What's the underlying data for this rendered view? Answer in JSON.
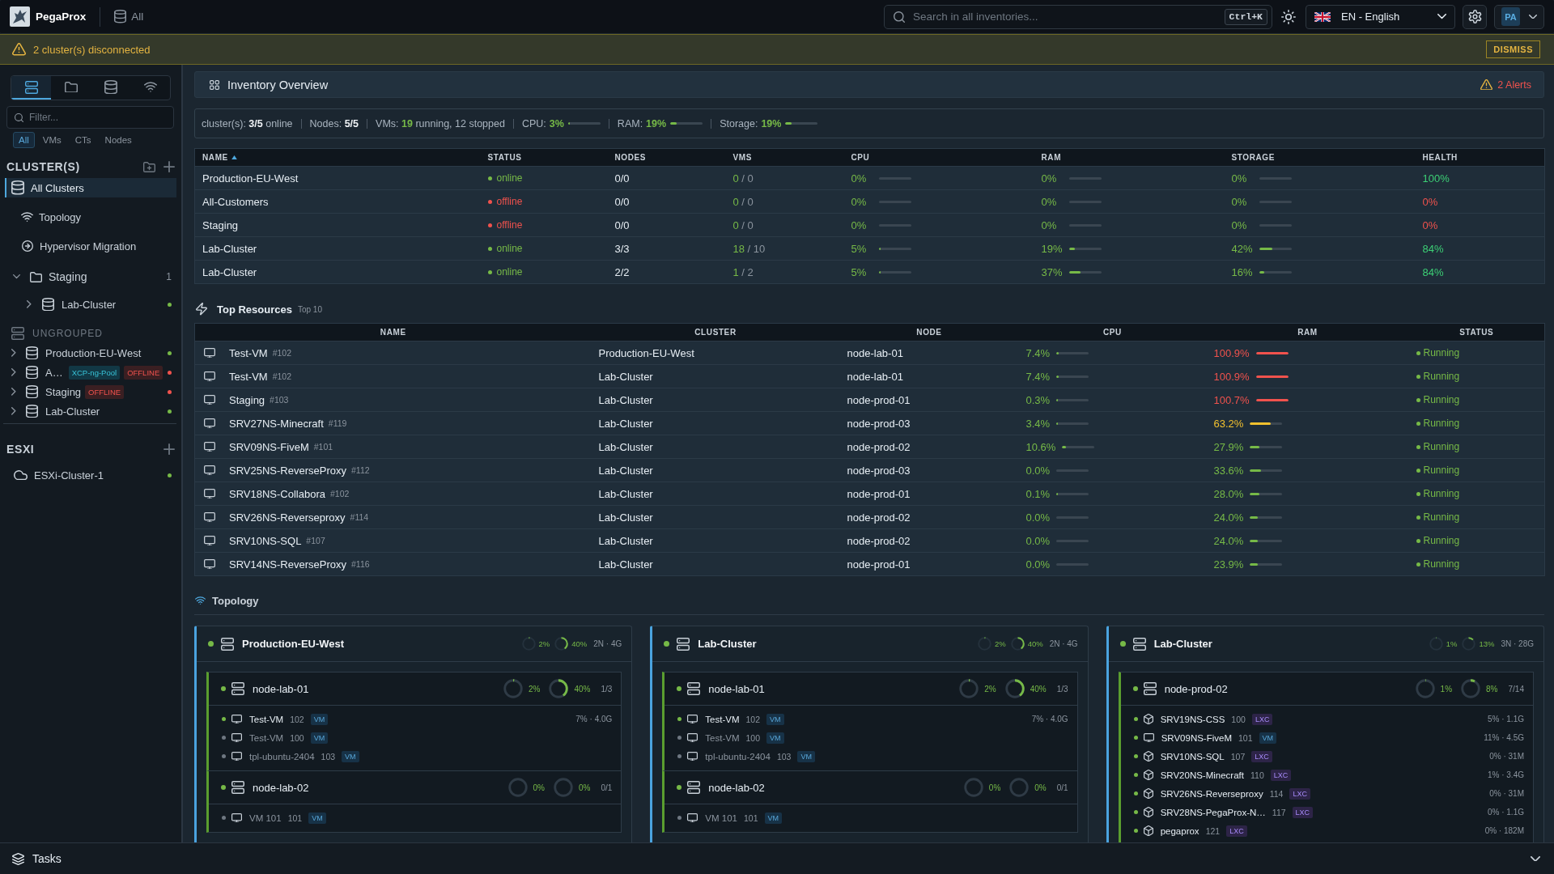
{
  "topbar": {
    "brand": "PegaProx",
    "scope": "All",
    "search": {
      "placeholder": "Search in all inventories...",
      "shortcut": "Ctrl+K"
    },
    "language": "EN - English",
    "user": {
      "initials": "PA"
    }
  },
  "alert_banner": {
    "message": "2 cluster(s) disconnected",
    "action": "DISMISS"
  },
  "sidebar": {
    "view_tabs": [
      {
        "kind": "servers",
        "selected": true
      },
      {
        "kind": "folders",
        "selected": false
      },
      {
        "kind": "storage",
        "selected": false
      },
      {
        "kind": "network",
        "selected": false
      }
    ],
    "filter": {
      "placeholder": "Filter..."
    },
    "filter_chips": [
      {
        "label": "All",
        "selected": true
      },
      {
        "label": "VMs",
        "selected": false
      },
      {
        "label": "CTs",
        "selected": false
      },
      {
        "label": "Nodes",
        "selected": false
      }
    ],
    "clusters": {
      "title": "CLUSTER(S)",
      "nav": [
        {
          "kind": "all",
          "label": "All Clusters",
          "selected": true
        },
        {
          "kind": "topology",
          "label": "Topology",
          "selected": false
        },
        {
          "kind": "migration",
          "label": "Hypervisor Migration",
          "selected": false
        }
      ],
      "groups": [
        {
          "label": "Staging",
          "count": "1",
          "expanded": true,
          "selected": false,
          "children": [
            {
              "label": "Lab-Cluster",
              "expanded": false,
              "online": true,
              "selected": false
            }
          ]
        }
      ],
      "ungrouped": {
        "title": "UNGROUPED",
        "items": [
          {
            "label": "Production-EU-West",
            "expanded": false,
            "online": true,
            "selected": false
          },
          {
            "label": "A…",
            "tag": "XCP-ng-Pool",
            "badge": "OFFLINE",
            "expanded": false,
            "online": false,
            "selected": false
          },
          {
            "label": "Staging",
            "badge": "OFFLINE",
            "expanded": false,
            "online": false,
            "selected": false
          },
          {
            "label": "Lab-Cluster",
            "expanded": false,
            "online": true,
            "selected": false
          }
        ]
      }
    },
    "esxi": {
      "title": "ESXI",
      "items": [
        {
          "label": "ESXi-Cluster-1",
          "online": true,
          "selected": false
        }
      ]
    }
  },
  "overview": {
    "title": "Inventory Overview",
    "alerts": "2 Alerts",
    "stats": [
      {
        "kind": "text",
        "text": "cluster(s): **3/5** online"
      },
      {
        "kind": "text",
        "text": "Nodes: **5/5**"
      },
      {
        "kind": "highlight",
        "text": "VMs: **19** running, 12 stopped"
      },
      {
        "kind": "meter",
        "label": "CPU:",
        "value": "3%",
        "level": 0.03
      },
      {
        "kind": "meter",
        "label": "RAM:",
        "value": "19%",
        "level": 0.19
      },
      {
        "kind": "meter",
        "label": "Storage:",
        "value": "19%",
        "level": 0.19
      }
    ]
  },
  "clusters_table": {
    "columns": [
      {
        "label": "NAME",
        "sorted": true
      },
      {
        "label": "STATUS",
        "sorted": false
      },
      {
        "label": "NODES",
        "sorted": false
      },
      {
        "label": "VMS",
        "sorted": false
      },
      {
        "label": "CPU",
        "sorted": false
      },
      {
        "label": "RAM",
        "sorted": false
      },
      {
        "label": "STORAGE",
        "sorted": false
      },
      {
        "label": "HEALTH",
        "sorted": false
      }
    ],
    "rows": [
      {
        "name": "Production-EU-West",
        "status": {
          "label": "online",
          "online": true
        },
        "nodes": "0/0",
        "vms": {
          "running": "0",
          "rest": "/ 0"
        },
        "cpu": {
          "value": "0%",
          "level": 0
        },
        "ram": {
          "value": "0%",
          "level": 0
        },
        "storage": {
          "value": "0%",
          "level": 0
        },
        "health": {
          "value": "100%",
          "healthy": true
        }
      },
      {
        "name": "All-Customers",
        "status": {
          "label": "offline",
          "online": false
        },
        "nodes": "0/0",
        "vms": {
          "running": "0",
          "rest": "/ 0"
        },
        "cpu": {
          "value": "0%",
          "level": 0
        },
        "ram": {
          "value": "0%",
          "level": 0
        },
        "storage": {
          "value": "0%",
          "level": 0
        },
        "health": {
          "value": "0%",
          "healthy": false
        }
      },
      {
        "name": "Staging",
        "status": {
          "label": "offline",
          "online": false
        },
        "nodes": "0/0",
        "vms": {
          "running": "0",
          "rest": "/ 0"
        },
        "cpu": {
          "value": "0%",
          "level": 0
        },
        "ram": {
          "value": "0%",
          "level": 0
        },
        "storage": {
          "value": "0%",
          "level": 0
        },
        "health": {
          "value": "0%",
          "healthy": false
        }
      },
      {
        "name": "Lab-Cluster",
        "status": {
          "label": "online",
          "online": true
        },
        "nodes": "3/3",
        "vms": {
          "running": "18",
          "rest": "/ 10"
        },
        "cpu": {
          "value": "5%",
          "level": 0.05
        },
        "ram": {
          "value": "19%",
          "level": 0.19
        },
        "storage": {
          "value": "42%",
          "level": 0.42
        },
        "health": {
          "value": "84%",
          "healthy": true
        }
      },
      {
        "name": "Lab-Cluster",
        "status": {
          "label": "online",
          "online": true
        },
        "nodes": "2/2",
        "vms": {
          "running": "1",
          "rest": "/ 2"
        },
        "cpu": {
          "value": "5%",
          "level": 0.05
        },
        "ram": {
          "value": "37%",
          "level": 0.37
        },
        "storage": {
          "value": "16%",
          "level": 0.16
        },
        "health": {
          "value": "84%",
          "healthy": true
        }
      }
    ]
  },
  "top_resources": {
    "title": "Top Resources",
    "badge": "Top 10",
    "columns": [
      "NAME",
      "CLUSTER",
      "NODE",
      "CPU",
      "RAM",
      "STATUS"
    ],
    "rows": [
      {
        "name": "Test-VM",
        "id": "#102",
        "cluster": "Production-EU-West",
        "node": "node-lab-01",
        "cpu": {
          "value": "7.4%",
          "level": 0.074
        },
        "ram": {
          "value": "100.9%",
          "level": 1
        },
        "status": {
          "label": "Running",
          "running": true
        }
      },
      {
        "name": "Test-VM",
        "id": "#102",
        "cluster": "Lab-Cluster",
        "node": "node-lab-01",
        "cpu": {
          "value": "7.4%",
          "level": 0.074
        },
        "ram": {
          "value": "100.9%",
          "level": 1
        },
        "status": {
          "label": "Running",
          "running": true
        }
      },
      {
        "name": "Staging",
        "id": "#103",
        "cluster": "Lab-Cluster",
        "node": "node-prod-01",
        "cpu": {
          "value": "0.3%",
          "level": 0.003
        },
        "ram": {
          "value": "100.7%",
          "level": 1
        },
        "status": {
          "label": "Running",
          "running": true
        }
      },
      {
        "name": "SRV27NS-Minecraft",
        "id": "#119",
        "cluster": "Lab-Cluster",
        "node": "node-prod-03",
        "cpu": {
          "value": "3.4%",
          "level": 0.034
        },
        "ram": {
          "value": "63.2%",
          "level": 0.632
        },
        "status": {
          "label": "Running",
          "running": true
        }
      },
      {
        "name": "SRV09NS-FiveM",
        "id": "#101",
        "cluster": "Lab-Cluster",
        "node": "node-prod-02",
        "cpu": {
          "value": "10.6%",
          "level": 0.106
        },
        "ram": {
          "value": "27.9%",
          "level": 0.279
        },
        "status": {
          "label": "Running",
          "running": true
        }
      },
      {
        "name": "SRV25NS-ReverseProxy",
        "id": "#112",
        "cluster": "Lab-Cluster",
        "node": "node-prod-03",
        "cpu": {
          "value": "0.0%",
          "level": 0
        },
        "ram": {
          "value": "33.6%",
          "level": 0.336
        },
        "status": {
          "label": "Running",
          "running": true
        }
      },
      {
        "name": "SRV18NS-Collabora",
        "id": "#102",
        "cluster": "Lab-Cluster",
        "node": "node-prod-01",
        "cpu": {
          "value": "0.1%",
          "level": 0.001
        },
        "ram": {
          "value": "28.0%",
          "level": 0.28
        },
        "status": {
          "label": "Running",
          "running": true
        }
      },
      {
        "name": "SRV26NS-Reverseproxy",
        "id": "#114",
        "cluster": "Lab-Cluster",
        "node": "node-prod-02",
        "cpu": {
          "value": "0.0%",
          "level": 0
        },
        "ram": {
          "value": "24.0%",
          "level": 0.24
        },
        "status": {
          "label": "Running",
          "running": true
        }
      },
      {
        "name": "SRV10NS-SQL",
        "id": "#107",
        "cluster": "Lab-Cluster",
        "node": "node-prod-02",
        "cpu": {
          "value": "0.0%",
          "level": 0
        },
        "ram": {
          "value": "24.0%",
          "level": 0.24
        },
        "status": {
          "label": "Running",
          "running": true
        }
      },
      {
        "name": "SRV14NS-ReverseProxy",
        "id": "#116",
        "cluster": "Lab-Cluster",
        "node": "node-prod-01",
        "cpu": {
          "value": "0.0%",
          "level": 0
        },
        "ram": {
          "value": "23.9%",
          "level": 0.239
        },
        "status": {
          "label": "Running",
          "running": true
        }
      }
    ]
  },
  "topology": {
    "title": "Topology",
    "clusters": [
      {
        "name": "Production-EU-West",
        "online": true,
        "cpu": {
          "label": "2%",
          "level": 0.02
        },
        "ram": {
          "label": "40%",
          "level": 0.4
        },
        "summary": "2N · 4G",
        "nodes": [
          {
            "name": "node-lab-01",
            "online": true,
            "cpu": {
              "label": "2%",
              "level": 0.02
            },
            "ram": {
              "label": "40%",
              "level": 0.4
            },
            "guests": "1/3",
            "vms": [
              {
                "kind": "vm",
                "name": "Test-VM",
                "id": "102",
                "tag": "VM",
                "running": true,
                "usage": "7% · 4.0G"
              },
              {
                "kind": "vm",
                "name": "Test-VM",
                "id": "100",
                "tag": "VM",
                "running": false
              },
              {
                "kind": "vm",
                "name": "tpl-ubuntu-2404",
                "id": "103",
                "tag": "VM",
                "running": false
              }
            ]
          },
          {
            "name": "node-lab-02",
            "online": true,
            "cpu": {
              "label": "0%",
              "level": 0
            },
            "ram": {
              "label": "0%",
              "level": 0
            },
            "guests": "0/1",
            "vms": [
              {
                "kind": "vm",
                "name": "VM 101",
                "id": "101",
                "tag": "VM",
                "running": false
              }
            ]
          }
        ]
      },
      {
        "name": "Lab-Cluster",
        "online": true,
        "cpu": {
          "label": "2%",
          "level": 0.02
        },
        "ram": {
          "label": "40%",
          "level": 0.4
        },
        "summary": "2N · 4G",
        "nodes": [
          {
            "name": "node-lab-01",
            "online": true,
            "cpu": {
              "label": "2%",
              "level": 0.02
            },
            "ram": {
              "label": "40%",
              "level": 0.4
            },
            "guests": "1/3",
            "vms": [
              {
                "kind": "vm",
                "name": "Test-VM",
                "id": "102",
                "tag": "VM",
                "running": true,
                "usage": "7% · 4.0G"
              },
              {
                "kind": "vm",
                "name": "Test-VM",
                "id": "100",
                "tag": "VM",
                "running": false
              },
              {
                "kind": "vm",
                "name": "tpl-ubuntu-2404",
                "id": "103",
                "tag": "VM",
                "running": false
              }
            ]
          },
          {
            "name": "node-lab-02",
            "online": true,
            "cpu": {
              "label": "0%",
              "level": 0
            },
            "ram": {
              "label": "0%",
              "level": 0
            },
            "guests": "0/1",
            "vms": [
              {
                "kind": "vm",
                "name": "VM 101",
                "id": "101",
                "tag": "VM",
                "running": false
              }
            ]
          }
        ]
      },
      {
        "name": "Lab-Cluster",
        "online": true,
        "cpu": {
          "label": "1%",
          "level": 0.01
        },
        "ram": {
          "label": "13%",
          "level": 0.13
        },
        "summary": "3N · 28G",
        "nodes": [
          {
            "name": "node-prod-02",
            "online": true,
            "cpu": {
              "label": "1%",
              "level": 0.01
            },
            "ram": {
              "label": "8%",
              "level": 0.08
            },
            "guests": "7/14",
            "vms": [
              {
                "kind": "lxc",
                "name": "SRV19NS-CSS",
                "id": "100",
                "tag": "LXC",
                "running": true,
                "usage": "5% · 1.1G"
              },
              {
                "kind": "vm",
                "name": "SRV09NS-FiveM",
                "id": "101",
                "tag": "VM",
                "running": true,
                "usage": "11% · 4.5G"
              },
              {
                "kind": "lxc",
                "name": "SRV10NS-SQL",
                "id": "107",
                "tag": "LXC",
                "running": true,
                "usage": "0% · 31M"
              },
              {
                "kind": "lxc",
                "name": "SRV20NS-Minecraft",
                "id": "110",
                "tag": "LXC",
                "running": true,
                "usage": "1% · 3.4G"
              },
              {
                "kind": "lxc",
                "name": "SRV26NS-Reverseproxy",
                "id": "114",
                "tag": "LXC",
                "running": true,
                "usage": "0% · 31M"
              },
              {
                "kind": "lxc",
                "name": "SRV28NS-PegaProx-N…",
                "id": "117",
                "tag": "LXC",
                "running": true,
                "usage": "0% · 1.1G"
              },
              {
                "kind": "lxc",
                "name": "pegaprox",
                "id": "121",
                "tag": "LXC",
                "running": true,
                "usage": "0% · 182M"
              }
            ]
          }
        ]
      }
    ]
  },
  "tasks_bar": {
    "label": "Tasks"
  }
}
